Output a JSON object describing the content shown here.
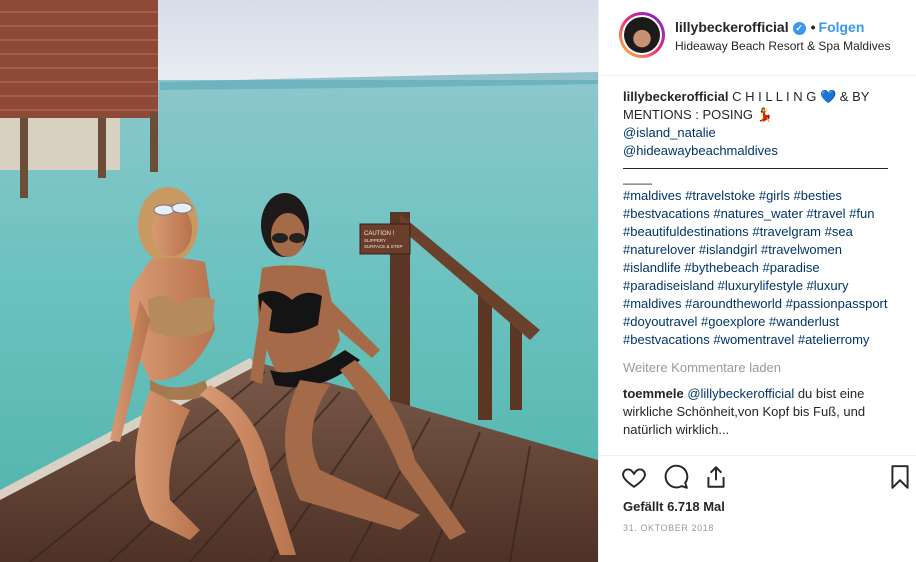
{
  "post": {
    "username": "lillybeckerofficial",
    "verified_icon": "verified-badge-icon",
    "dot": "•",
    "follow_label": "Folgen",
    "location": "Hideaway Beach Resort & Spa Maldives",
    "photo_sign": [
      "CAUTION !",
      "SLIPPERY",
      "SURFACE & STEP"
    ]
  },
  "caption": {
    "username": "lillybeckerofficial",
    "text": " C H I L L I N G 💙 & BY MENTIONS : POSING 💃",
    "mention1": "@island_natalie",
    "mention2": "@hideawaybeachmaldives",
    "separator": "____",
    "hashtags": "#maldives #travelstoke #girls #besties #bestvacations #natures_water #travel #fun #beautifuldestinations #travelgram #sea #naturelover #islandgirl #travelwomen #islandlife #bythebeach #paradise #paradiseisland #luxurylifestyle #luxury #maldives #aroundtheworld #passionpassport #doyoutravel #goexplore #wanderlust #bestvacations #womentravel #atelierromy"
  },
  "load_more": "Weitere Kommentare laden",
  "comment": {
    "username": "toemmele",
    "mention": "@lillybeckerofficial",
    "text": " du bist eine wirkliche Schönheit,von Kopf bis Fuß, und natürlich wirklich..."
  },
  "actions": {
    "like_icon": "heart-icon",
    "comment_icon": "comment-icon",
    "share_icon": "share-icon",
    "save_icon": "bookmark-icon"
  },
  "likes": "Gefällt 6.718 Mal",
  "date": "31. OKTOBER 2018",
  "colors": {
    "link": "#003569",
    "accent": "#3897f0",
    "muted": "#999999",
    "text": "#262626"
  }
}
